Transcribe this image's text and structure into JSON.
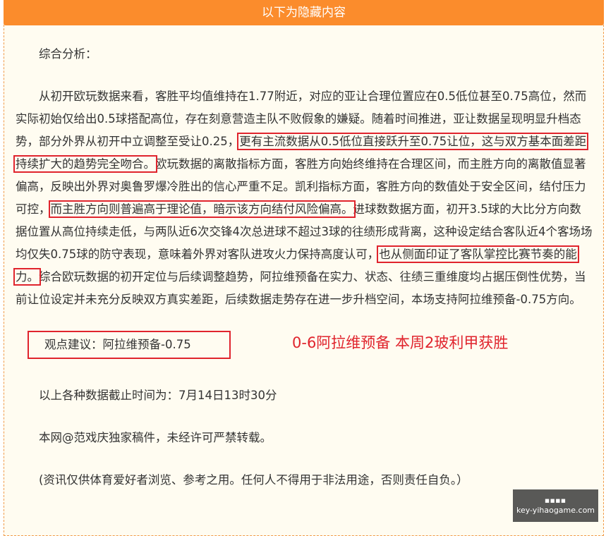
{
  "header": {
    "title": "以下为隐藏内容"
  },
  "section_title": "综合分析：",
  "analysis": {
    "s1": "从初开欧玩数据来看，客胜平均值维持在1.77附近，对应的亚让合理位置应在0.5低位甚至0.75高位，然而实际初始仅给出0.5球搭配高位，存在刻意营造主队不败假象的嫌疑。随着时间推进，亚让数据呈现明显升档态势，部分外界从初开中立调整至受让0.25，",
    "h1": "更有主流数据从0.5低位直接跃升至0.75让位，这与双方基本面差距持续扩大的趋势完全吻合。",
    "s2": "欧玩数据的离散指标方面，客胜方向始终维持在合理区间，而主胜方向的离散值显著偏高，反映出外界对奥鲁罗爆冷胜出的信心严重不足。凯利指标方面，客胜方向的数值处于安全区间，结付压力可控，",
    "h2": "而主胜方向则普遍高于理论值，暗示该方向结付风险偏高。",
    "s3": "进球数数据方面，初开3.5球的大比分方向数据位置从高位持续走低，与两队近6次交锋4次总进球不超过3球的往绩形成背离，这种设定结合客队近4个客场场均仅失0.75球的防守表现，意味着外界对客队进攻火力保持高度认可，",
    "h3": "也从侧面印证了客队掌控比赛节奏的能力。",
    "s4": "综合欧玩数据的初开定位与后续调整趋势，阿拉维预备在实力、状态、往绩三重维度均占据压倒性优势，当前让位设定并未充分反映双方真实差距，后续数据走势存在进一步升档空间，本场支持阿拉维预备-0.75方向。"
  },
  "advice": {
    "text": "观点建议：阿拉维预备-0.75",
    "result": "0-6阿拉维预备 本周2玻利甲获胜"
  },
  "deadline": "以上各种数据截止时间为：7月14日13时30分",
  "copyright": "本网@范戏庆独家稿件，未经许可严禁转载。",
  "disclaimer": "(资讯仅供体育爱好者浏览、参考之用。任何人不得用于非法用途，否则责任自负。）",
  "watermark": {
    "glyphs": "■■■■",
    "site": "key-yihaogame.com"
  },
  "colors": {
    "header_bg": "#fb8c2c",
    "highlight": "#e0242d",
    "panel_bg": "#fffcf1"
  }
}
